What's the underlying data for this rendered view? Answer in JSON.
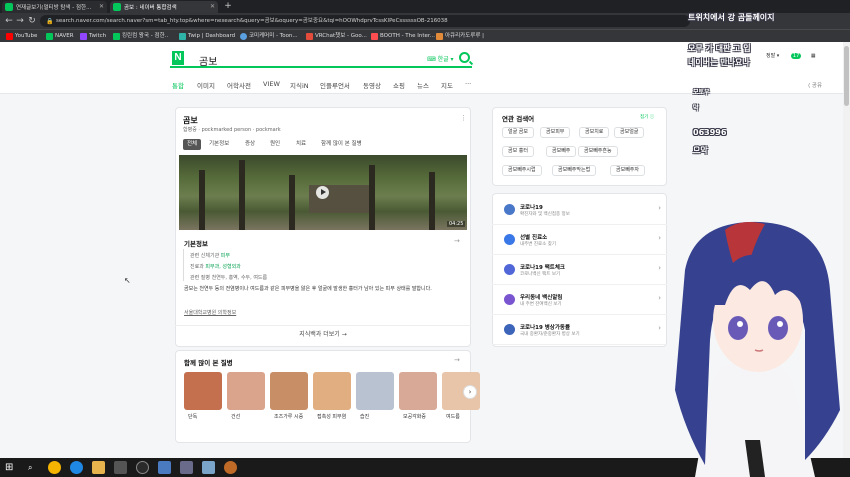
{
  "browser": {
    "tabs": [
      {
        "label": "연재글보기(멀티방 탐색 - 점한..."
      },
      {
        "label": "곰보 : 네이버 통합검색"
      }
    ],
    "url": "search.naver.com/search.naver?sm=tab_hty.top&where=nexearch&query=곰보&oquery=곰보중요&tqi=hOOWhdprvTcssKlPeCssssssOB-216038",
    "bookmarks": [
      {
        "label": "YouTube",
        "color": "#ff0000"
      },
      {
        "label": "NAVER",
        "color": "#03c75a"
      },
      {
        "label": "Twitch",
        "color": "#9146ff"
      },
      {
        "label": "킹린컴 왕국 - 점한..",
        "color": "#03c75a"
      },
      {
        "label": "Twip | Dashboard",
        "color": "#2fb5a8"
      },
      {
        "label": "코미케머미 - Toon...",
        "color": "#5aa0e0"
      },
      {
        "label": "VRChat챗보 - Goo...",
        "color": "#e34b3b"
      },
      {
        "label": "BOOTH - The Inter...",
        "color": "#fc4d50"
      },
      {
        "label": "아큐리카도루루 |",
        "color": "#e08a3a"
      }
    ]
  },
  "search": {
    "query": "곰보",
    "keyboard_hint": "⌨ 한글 ▾",
    "tabs": [
      "통합",
      "이미지",
      "어학사전",
      "VIEW",
      "지식iN",
      "인플루언서",
      "동영상",
      "쇼핑",
      "뉴스",
      "지도",
      "···"
    ],
    "share": "⟨ 공유"
  },
  "main_card": {
    "title": "곰보",
    "subtitle": "합병증 · pockmarked person · pockmark",
    "chips": [
      "전체",
      "기본정보",
      "증상",
      "원인",
      "치료",
      "함께 많이 본 질병"
    ],
    "video_duration": "04:25",
    "section_title": "기본정보",
    "info_rows": [
      {
        "label": "관련 신체기관 ",
        "value": "피부",
        "rest": ""
      },
      {
        "label": "진료과 ",
        "value": "피부과, 성형외과",
        "rest": ""
      },
      {
        "label": "관련 질병 ",
        "value": "",
        "rest": "천연두, 홍역, 수두, 여드름"
      }
    ],
    "description": "곰보는 천연두 등의 전염병이나 여드름과 같은 피부병을 앓은 후 얼굴에 발생한 흉터가 남아 있는 피부 상태를 말합니다.",
    "source": "서울대학교병원 의학정보",
    "more": "지식백과 더보기 →"
  },
  "diseases": {
    "title": "함께 많이 본 질병",
    "items": [
      {
        "label": "단독",
        "color": "#c4704f"
      },
      {
        "label": "건선",
        "color": "#d9a38c"
      },
      {
        "label": "조즈가루 시증",
        "color": "#c88f66"
      },
      {
        "label": "접촉성 피부염",
        "color": "#e0ae80"
      },
      {
        "label": "습진",
        "color": "#b9c2d0"
      },
      {
        "label": "모공각화증",
        "color": "#d8a996"
      },
      {
        "label": "여드름",
        "color": "#e8c4a8"
      }
    ]
  },
  "related": {
    "title": "연관 검색어",
    "control": "접기 ⓘ",
    "chips": [
      "얼굴 곰보",
      "곰보피부",
      "곰보치료",
      "곰보얼굴",
      "곰보 흉터",
      "곰보빼주",
      "곰보빼주흔능",
      "곰보빼주시럽",
      "곰보빼주막는법",
      "곰보빼주자"
    ]
  },
  "covid": {
    "rows": [
      {
        "title": "코로나19",
        "sub": "확진자와 및 백신접종 정보",
        "color": "#4a78c8"
      },
      {
        "title": "선별 진료소",
        "sub": "내주변 진료소 찾기",
        "color": "#3b78e7"
      },
      {
        "title": "코로나19 팩트체크",
        "sub": "코로나백신 팩트 보기",
        "color": "#5167d8"
      },
      {
        "title": "우리동네 백신알림",
        "sub": "내 주변 잔여백신 보기",
        "color": "#7a55d0"
      },
      {
        "title": "코로나19 병상가동률",
        "sub": "국내 중환자/준중환자 병상 보기",
        "color": "#3c64b8"
      }
    ]
  },
  "overlay": {
    "lines": [
      "트위치에서 강 곰돌께이지",
      "오무 가 대판 고 입",
      "네이버는 만나요나",
      "오토우",
      "약",
      "063996",
      "으악"
    ]
  },
  "header_right": {
    "sign_in": "정말 ▾",
    "badge": "17"
  }
}
